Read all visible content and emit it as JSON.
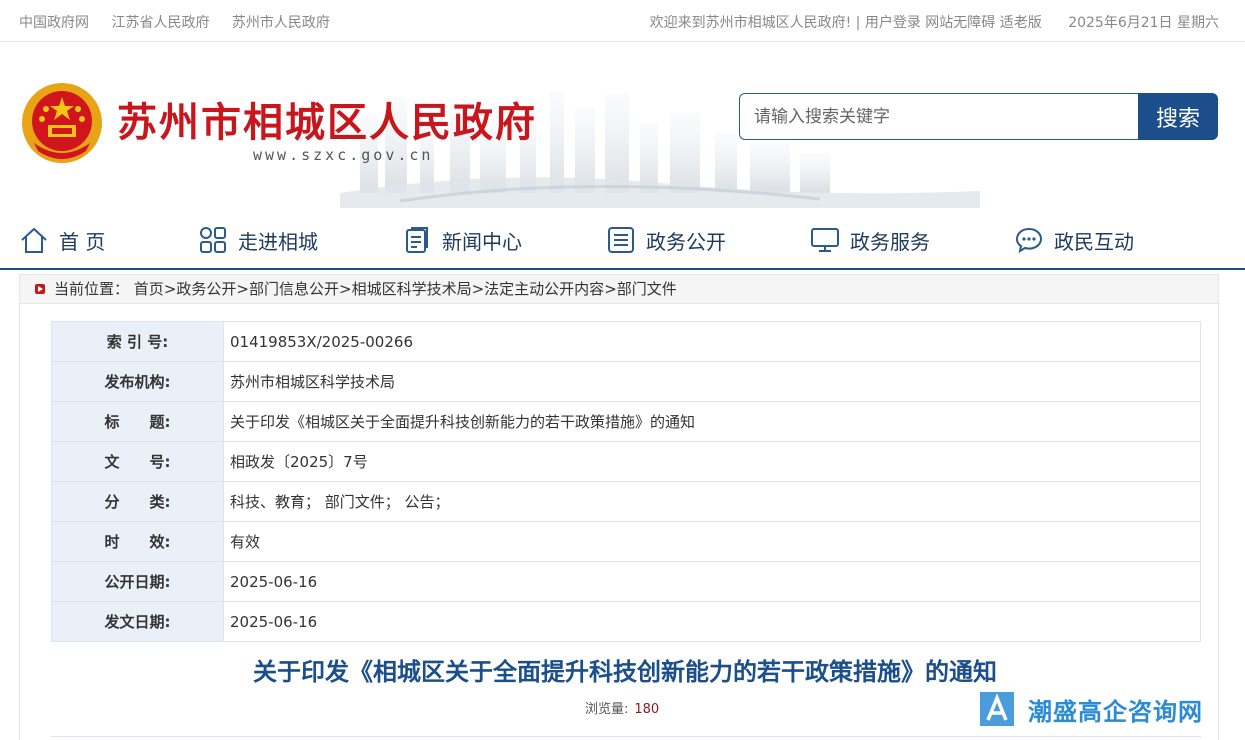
{
  "topbar": {
    "links": [
      "中国政府网",
      "江苏省人民政府",
      "苏州市人民政府"
    ],
    "welcome": "欢迎来到苏州市相城区人民政府! | 用户登录  网站无障碍  适老版",
    "date": "2025年6月21日 星期六"
  },
  "header": {
    "site_title": "苏州市相城区人民政府",
    "site_url": "www.szxc.gov.cn",
    "search_placeholder": "请输入搜索关键字",
    "search_button": "搜索"
  },
  "nav": {
    "items": [
      {
        "label": "首 页",
        "icon": "home-icon"
      },
      {
        "label": "走进相城",
        "icon": "grid-icon"
      },
      {
        "label": "新闻中心",
        "icon": "document-icon"
      },
      {
        "label": "政务公开",
        "icon": "list-icon"
      },
      {
        "label": "政务服务",
        "icon": "monitor-icon"
      },
      {
        "label": "政民互动",
        "icon": "chat-icon"
      }
    ]
  },
  "breadcrumb": {
    "prefix": "当前位置：",
    "items": [
      "首页",
      "政务公开",
      "部门信息公开",
      "相城区科学技术局",
      "法定主动公开内容",
      "部门文件"
    ],
    "separator": ">"
  },
  "info_table": [
    {
      "label": "索 引 号:",
      "value": "01419853X/2025-00266"
    },
    {
      "label": "发布机构:",
      "value": "苏州市相城区科学技术局"
    },
    {
      "label": "标　　题:",
      "value": "关于印发《相城区关于全面提升科技创新能力的若干政策措施》的通知"
    },
    {
      "label": "文　　号:",
      "value": "相政发〔2025〕7号"
    },
    {
      "label": "分　　类:",
      "value": "科技、教育；  部门文件；  公告；"
    },
    {
      "label": "时　　效:",
      "value": "有效"
    },
    {
      "label": "公开日期:",
      "value": "2025-06-16"
    },
    {
      "label": "发文日期:",
      "value": "2025-06-16"
    }
  ],
  "document": {
    "title": "关于印发《相城区关于全面提升科技创新能力的若干政策措施》的通知",
    "views_label": "浏览量:",
    "views_count": "180"
  },
  "watermark": {
    "text": "潮盛高企咨询网"
  },
  "colors": {
    "brand_red": "#c8161d",
    "brand_blue": "#1b4e8a",
    "label_bg": "#e9f0f8"
  }
}
